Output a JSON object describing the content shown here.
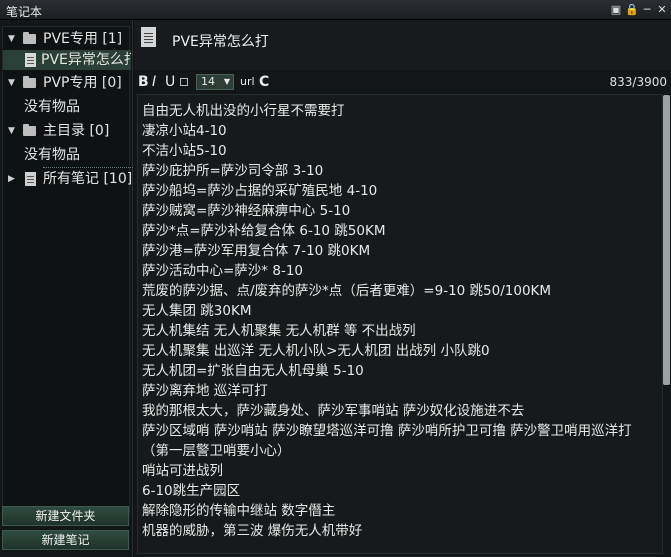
{
  "window": {
    "title": "笔记本",
    "buttons": [
      "▣",
      "🔒",
      "─",
      "✕"
    ]
  },
  "sidebar": {
    "tree": [
      {
        "type": "folder",
        "label": "PVE专用 [1]",
        "expanded": true
      },
      {
        "type": "note",
        "label": "PVE异常怎么打",
        "selected": true
      },
      {
        "type": "folder",
        "label": "PVP专用 [0]",
        "expanded": true
      },
      {
        "type": "empty",
        "label": "没有物品"
      },
      {
        "type": "folder",
        "label": "主目录 [0]",
        "expanded": true
      },
      {
        "type": "empty",
        "label": "没有物品"
      },
      {
        "type": "all",
        "label": "所有笔记 [10]",
        "expanded": false
      }
    ],
    "buttons": {
      "new_folder": "新建文件夹",
      "new_note": "新建笔记"
    }
  },
  "note": {
    "title": "PVE异常怎么打",
    "toolbar": {
      "bold": "B",
      "italic": "I",
      "underline": "U",
      "font_size": "14",
      "url": "url",
      "color": "C",
      "char_count": "833/3900"
    },
    "lines": [
      "自由无人机出没的小行星不需要打",
      "凄凉小站4-10",
      "不洁小站5-10",
      "萨沙庇护所=萨沙司令部      3-10",
      "萨沙船坞=萨沙占据的采矿殖民地  4-10",
      "萨沙贼窝=萨沙神经麻痹中心  5-10",
      "萨沙*点=萨沙补给复合体      6-10  跳50KM",
      "萨沙港=萨沙军用复合体       7-10  跳0KM",
      "萨沙活动中心=萨沙*       8-10",
      "荒废的萨沙据、点/废弃的萨沙*点（后者更难）=9-10     跳50/100KM",
      "无人集团 跳30KM",
      "无人机集结  无人机聚集  无人机群  等  不出战列",
      "无人机聚集  出巡洋   无人机小队>无人机团   出战列  小队跳0",
      "无人机团=扩张自由无人机母巢 5-10",
      "萨沙离弃地  巡洋可打",
      "我的那根太大，萨沙藏身处、萨沙军事哨站  萨沙奴化设施进不去",
      "萨沙区域哨  萨沙哨站  萨沙瞭望塔巡洋可撸  萨沙哨所护卫可撸   萨沙警卫哨用巡洋打",
      "（第一层警卫哨要小心）",
      "哨站可进战列",
      "6-10跳生产园区",
      "解除隐形的传输中继站   数字僭主",
      "机器的威胁，第三波  爆伤无人机带好"
    ]
  },
  "colors": {
    "accent": "#2a3f36",
    "button": "#2f4a3f",
    "background": "#0f1214"
  }
}
